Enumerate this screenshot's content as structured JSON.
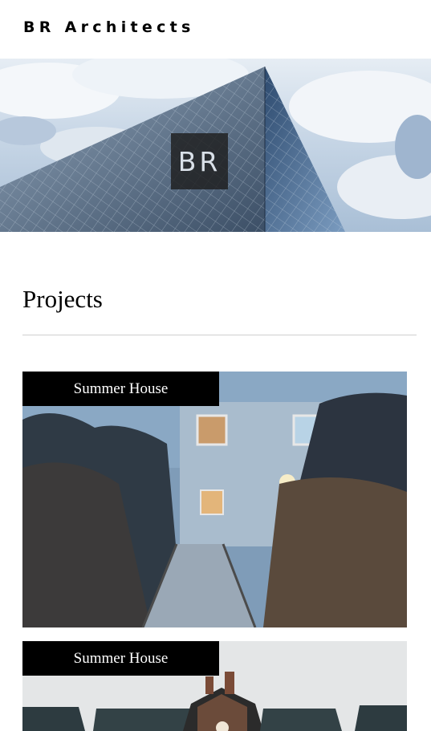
{
  "site": {
    "brand": "BR Architects"
  },
  "hero": {
    "badge_text": "BR"
  },
  "projects": {
    "heading": "Projects",
    "items": [
      {
        "title": "Summer House"
      },
      {
        "title": "Summer House"
      }
    ]
  }
}
